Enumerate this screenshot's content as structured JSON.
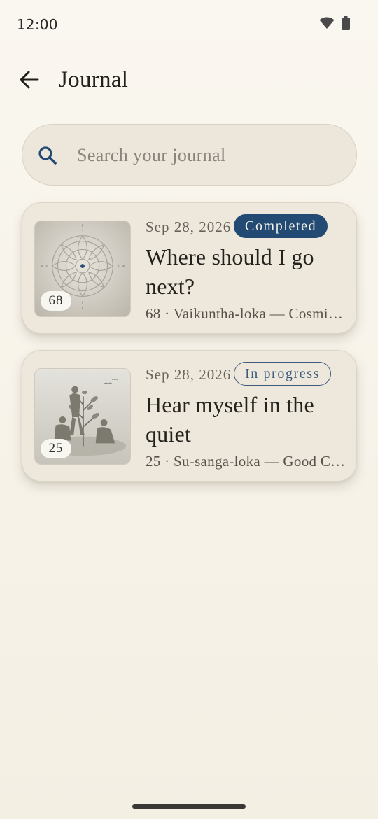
{
  "status_bar": {
    "time": "12:00",
    "icons": [
      "wifi-icon",
      "battery-icon"
    ]
  },
  "app_bar": {
    "back_icon": "arrow-left-icon",
    "title": "Journal"
  },
  "search": {
    "icon": "search-icon",
    "placeholder": "Search your journal",
    "value": ""
  },
  "entries": [
    {
      "date": "Sep 28, 2026",
      "status": "Completed",
      "title": "Where should I go next?",
      "meta": "68 · Vaikuntha-loka — Cosmic…",
      "thumb_number": "68",
      "thumb_icon": "mandala-icon"
    },
    {
      "date": "Sep 28, 2026",
      "status": "In progress",
      "title": "Hear myself in the quiet",
      "meta": "25 · Su-sanga-loka — Good Co…",
      "thumb_number": "25",
      "thumb_icon": "people-planting-tree-icon"
    }
  ],
  "colors": {
    "background": "#f7f3ea",
    "card": "#eee7dc",
    "accent_navy": "#234a73",
    "chip_outline": "#3c5c7e"
  }
}
